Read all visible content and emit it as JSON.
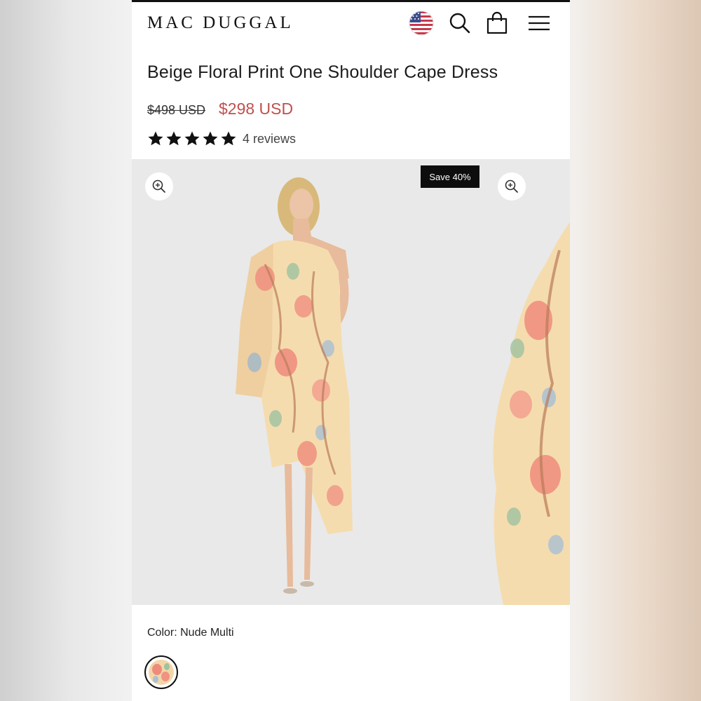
{
  "brand": {
    "logo_text": "MAC DUGGAL"
  },
  "header": {
    "icons": [
      "us-flag-icon",
      "search-icon",
      "shopping-bag-icon",
      "hamburger-menu-icon"
    ]
  },
  "product": {
    "title": "Beige Floral Print One Shoulder Cape Dress",
    "original_price": "$498 USD",
    "sale_price": "$298 USD",
    "rating_stars": 5,
    "reviews_label": "4 reviews",
    "badge": "Save 40%",
    "color_label": "Color: Nude Multi"
  },
  "colors": {
    "sale": "#c0504d",
    "badge_bg": "#0d0d0d",
    "gallery_bg": "#e9e9e9"
  }
}
